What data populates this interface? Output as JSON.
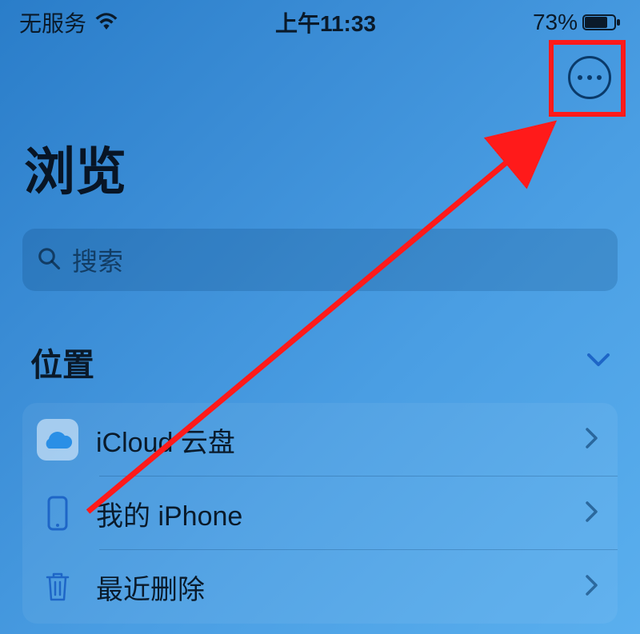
{
  "status_bar": {
    "carrier": "无服务",
    "time": "上午11:33",
    "battery_percent": "73%"
  },
  "page_title": "浏览",
  "search": {
    "placeholder": "搜索"
  },
  "section": {
    "title": "位置"
  },
  "locations": [
    {
      "icon": "cloud-icon",
      "label": "iCloud 云盘"
    },
    {
      "icon": "phone-icon",
      "label": "我的 iPhone"
    },
    {
      "icon": "trash-icon",
      "label": "最近删除"
    }
  ],
  "colors": {
    "annotation": "#ff1a1a",
    "icloud_icon": "#2a8fe6",
    "iphone_icon": "#1e66c7",
    "trash_icon": "#1e66c7"
  }
}
